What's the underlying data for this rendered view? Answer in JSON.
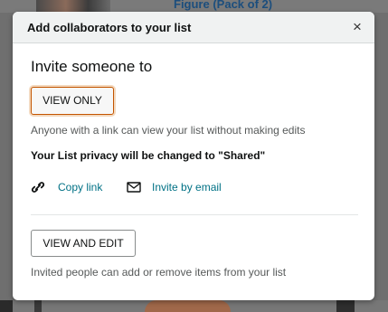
{
  "background": {
    "partial_link_text": "Figure (Pack of 2)"
  },
  "dialog": {
    "title": "Add collaborators to your list",
    "close_glyph": "×",
    "heading": "Invite someone to",
    "view_only_label": "VIEW ONLY",
    "view_only_description": "Anyone with a link can view your list without making edits",
    "privacy_notice": "Your List privacy will be changed to \"Shared\"",
    "copy_link_label": "Copy link",
    "copy_link_icon": "link-icon",
    "invite_email_label": "Invite by email",
    "invite_email_icon": "envelope-icon",
    "view_edit_label": "VIEW AND EDIT",
    "view_edit_description": "Invited people can add or remove items from your list"
  },
  "colors": {
    "link": "#007185",
    "selected_border": "#c45500",
    "header_bg": "#f0f2f2",
    "overlay": "#6f6f6f"
  }
}
